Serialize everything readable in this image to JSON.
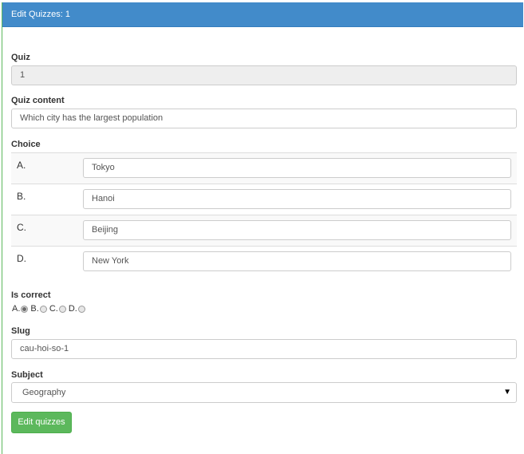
{
  "header": {
    "title": "Edit Quizzes: 1"
  },
  "form": {
    "quiz_label": "Quiz",
    "quiz_value": "1",
    "content_label": "Quiz content",
    "content_value": "Which city has the largest population",
    "choice_label": "Choice",
    "choices": [
      {
        "letter": "A.",
        "value": "Tokyo"
      },
      {
        "letter": "B.",
        "value": "Hanoi"
      },
      {
        "letter": "C.",
        "value": "Beijing"
      },
      {
        "letter": "D.",
        "value": "New York"
      }
    ],
    "correct_label": "Is correct",
    "correct_options": [
      {
        "label": "A.",
        "checked": true
      },
      {
        "label": "B.",
        "checked": false
      },
      {
        "label": "C.",
        "checked": false
      },
      {
        "label": "D.",
        "checked": false
      }
    ],
    "slug_label": "Slug",
    "slug_value": "cau-hoi-so-1",
    "subject_label": "Subject",
    "subject_value": "Geography",
    "submit_label": "Edit quizzes"
  },
  "colors": {
    "header_bg": "#428bca",
    "button_bg": "#5cb85c",
    "readonly_bg": "#eeeeee"
  }
}
